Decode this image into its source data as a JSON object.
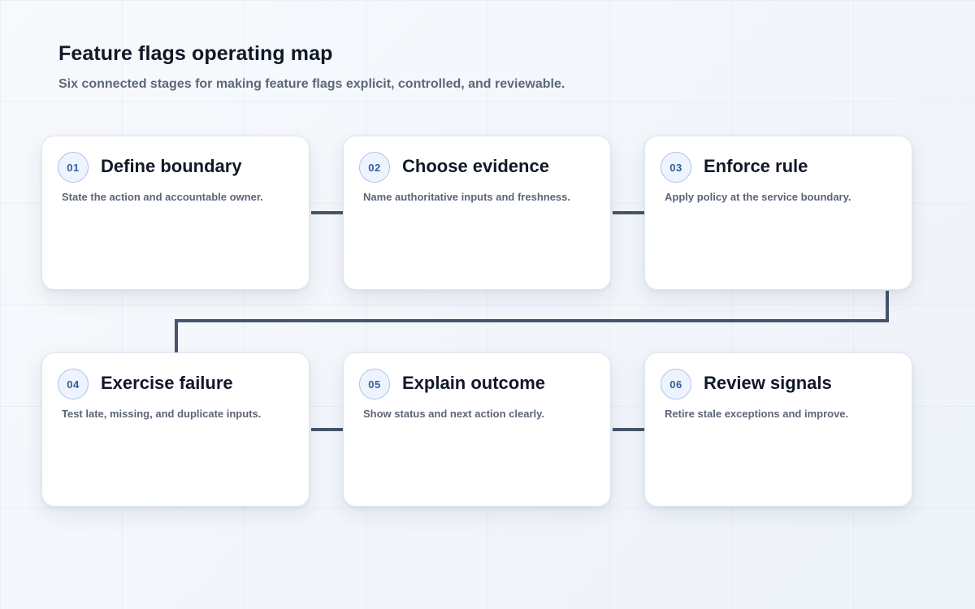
{
  "header": {
    "title": "Feature flags operating map",
    "subtitle": "Six connected stages for making feature flags explicit, controlled, and reviewable."
  },
  "stages": [
    {
      "number": "01",
      "title": "Define boundary",
      "description": "State the action and accountable owner."
    },
    {
      "number": "02",
      "title": "Choose evidence",
      "description": "Name authoritative inputs and freshness."
    },
    {
      "number": "03",
      "title": "Enforce rule",
      "description": "Apply policy at the service boundary."
    },
    {
      "number": "04",
      "title": "Exercise failure",
      "description": "Test late, missing, and duplicate inputs."
    },
    {
      "number": "05",
      "title": "Explain outcome",
      "description": "Show status and next action clearly."
    },
    {
      "number": "06",
      "title": "Review signals",
      "description": "Retire stale exceptions and improve."
    }
  ],
  "colors": {
    "connector": "#465569",
    "badge_text": "#2f5e9e",
    "badge_border": "#a9c3ec",
    "title_text": "#101827",
    "subtitle_text": "#5c6779"
  }
}
